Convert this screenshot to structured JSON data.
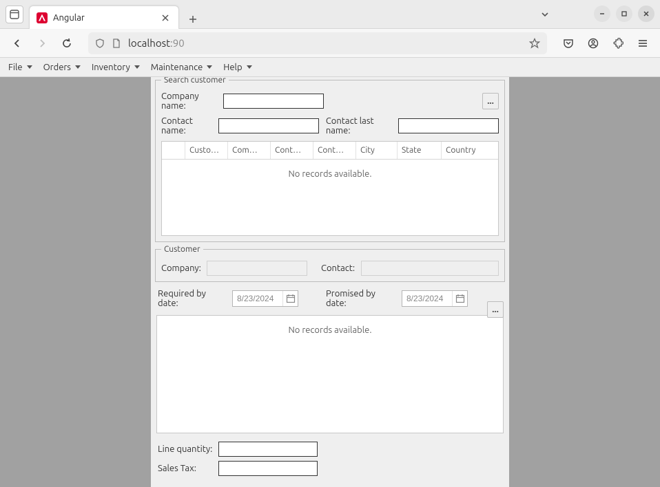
{
  "browser": {
    "tab_title": "Angular",
    "url_host": "localhost",
    "url_suffix": ":90"
  },
  "menubar": {
    "items": [
      "File",
      "Orders",
      "Inventory",
      "Maintenance",
      "Help"
    ]
  },
  "search_customer": {
    "legend": "Search customer",
    "company_name_label": "Company name:",
    "contact_name_label": "Contact name:",
    "contact_last_name_label": "Contact last name:",
    "ellipsis_label": "...",
    "grid": {
      "columns": [
        "Custo…",
        "Com…",
        "Cont…",
        "Cont…",
        "City",
        "State",
        "Country"
      ],
      "no_records": "No records available."
    }
  },
  "customer": {
    "legend": "Customer",
    "company_label": "Company:",
    "contact_label": "Contact:"
  },
  "dates": {
    "required_label": "Required by date:",
    "promised_label": "Promised by date:",
    "required_value": "8/23/2024",
    "promised_value": "8/23/2024",
    "ellipsis_label": "..."
  },
  "items_grid": {
    "no_records": "No records available."
  },
  "totals": {
    "line_qty_label": "Line quantity:",
    "sales_tax_label": "Sales Tax:"
  }
}
